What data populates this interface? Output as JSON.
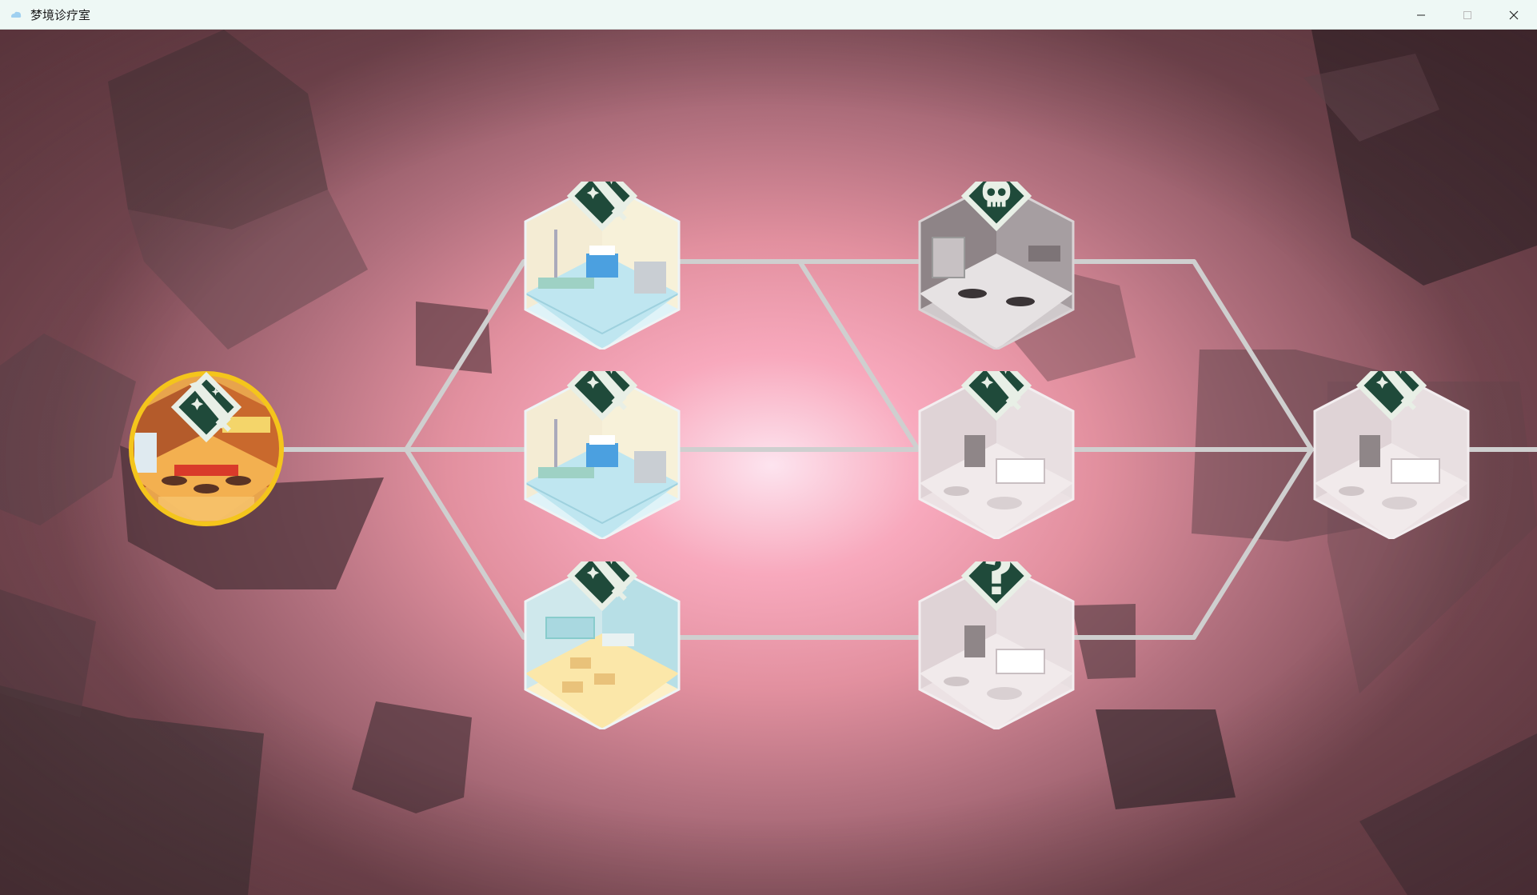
{
  "window": {
    "title": "梦境诊疗室",
    "controls": {
      "minimize_icon": "minimize-icon",
      "maximize_icon": "maximize-icon",
      "close_icon": "close-icon"
    }
  },
  "map": {
    "nodes": [
      {
        "id": "start",
        "room": "cafe",
        "icon": "sword-icon",
        "state": "current",
        "shape": "circle"
      },
      {
        "id": "c1-top",
        "room": "clinic",
        "icon": "sword-icon",
        "state": "available"
      },
      {
        "id": "c1-mid",
        "room": "clinic",
        "icon": "sword-icon",
        "state": "available"
      },
      {
        "id": "c1-bot",
        "room": "classroom",
        "icon": "sword-icon",
        "state": "available"
      },
      {
        "id": "c2-top",
        "room": "gray-room",
        "icon": "skull-icon",
        "state": "locked"
      },
      {
        "id": "c2-mid",
        "room": "bedroom",
        "icon": "sword-icon",
        "state": "locked"
      },
      {
        "id": "c2-bot",
        "room": "bedroom",
        "icon": "question-icon",
        "state": "locked"
      },
      {
        "id": "c3",
        "room": "bedroom",
        "icon": "sword-icon",
        "state": "locked"
      }
    ],
    "colors": {
      "path": "#c9c9c9",
      "current_ring": "#f4c51c",
      "icon_dark": "#1f4a3a",
      "icon_light": "#e8efe6"
    }
  }
}
